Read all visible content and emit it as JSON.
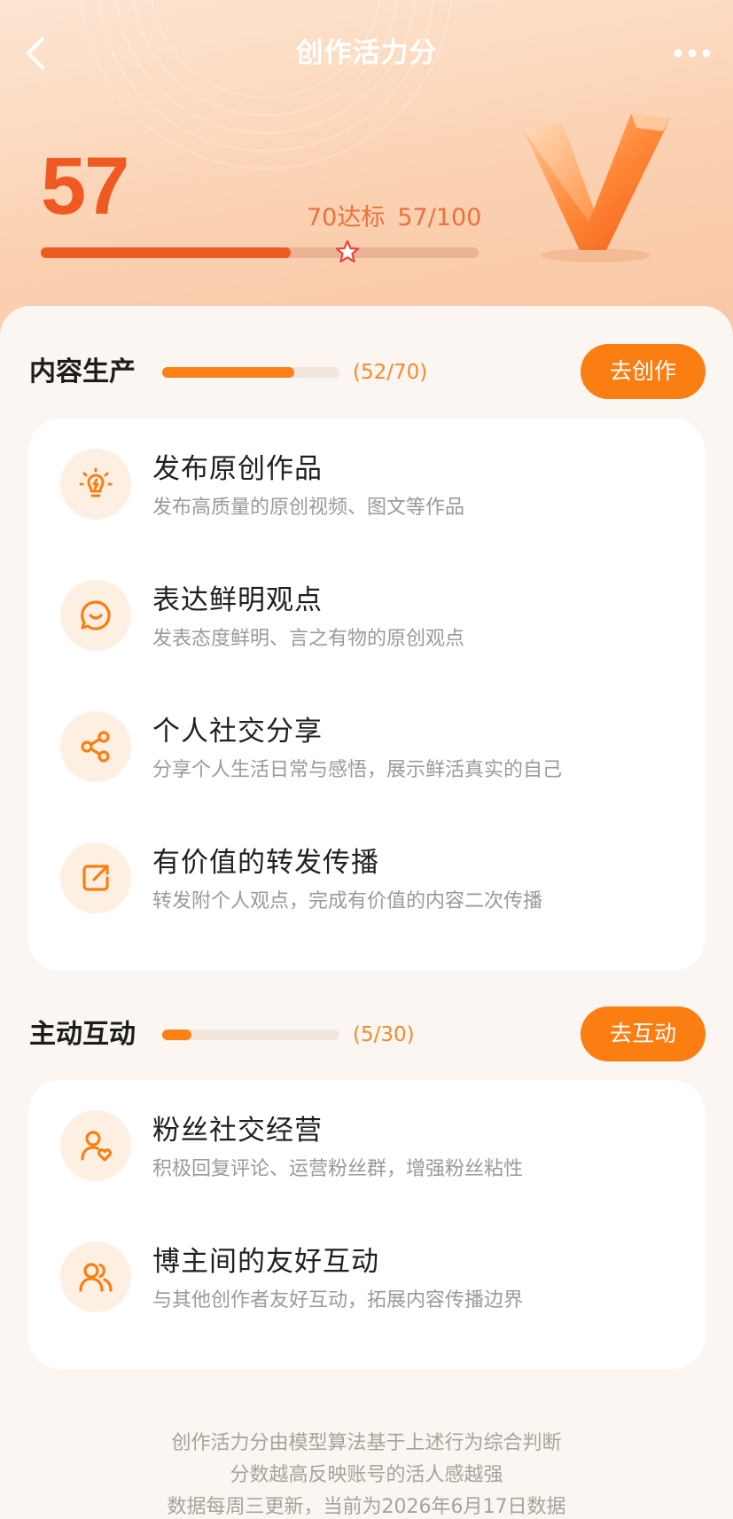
{
  "nav": {
    "title": "创作活力分",
    "back_icon": "chevron-left-icon",
    "more_icon": "more-dots-icon"
  },
  "score": {
    "value": "57",
    "target_label": "70达标",
    "ratio_label": "57/100",
    "current": 57,
    "max": 100,
    "target": 70
  },
  "sections": [
    {
      "title": "内容生产",
      "count_label": "(52/70)",
      "current": 52,
      "max": 70,
      "button_label": "去创作",
      "items": [
        {
          "icon": "lightbulb-icon",
          "title": "发布原创作品",
          "desc": "发布高质量的原创视频、图文等作品"
        },
        {
          "icon": "chat-smile-icon",
          "title": "表达鲜明观点",
          "desc": "发表态度鲜明、言之有物的原创观点"
        },
        {
          "icon": "share-icon",
          "title": "个人社交分享",
          "desc": "分享个人生活日常与感悟，展示鲜活真实的自己"
        },
        {
          "icon": "forward-icon",
          "title": "有价值的转发传播",
          "desc": "转发附个人观点，完成有价值的内容二次传播"
        }
      ]
    },
    {
      "title": "主动互动",
      "count_label": "(5/30)",
      "current": 5,
      "max": 30,
      "button_label": "去互动",
      "items": [
        {
          "icon": "user-heart-icon",
          "title": "粉丝社交经营",
          "desc": "积极回复评论、运营粉丝群，增强粉丝粘性"
        },
        {
          "icon": "users-icon",
          "title": "博主间的友好互动",
          "desc": "与其他创作者友好互动，拓展内容传播边界"
        }
      ]
    }
  ],
  "footer": {
    "lines": [
      "创作活力分由模型算法基于上述行为综合判断",
      "分数越高反映账号的活人感越强",
      "数据每周三更新，当前为2026年6月17日数据"
    ]
  },
  "colors": {
    "accent": "#fb7e12",
    "score": "#ef5a22",
    "icon_bg": "#fdf0e3"
  }
}
